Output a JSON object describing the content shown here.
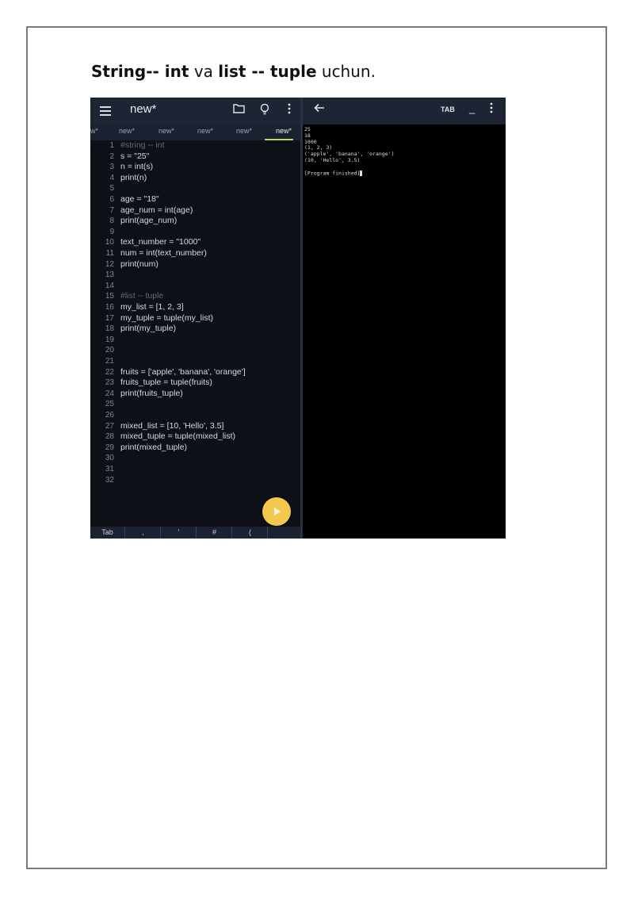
{
  "document": {
    "heading": {
      "part1": "String-- int",
      "part2": " va ",
      "part3": "list -- tuple",
      "part4": " uchun."
    }
  },
  "screenshot": {
    "editor": {
      "title": "new*",
      "icons": [
        "menu-icon",
        "folder-icon",
        "lightbulb-icon",
        "more-vert-icon"
      ],
      "tabs": [
        "w*",
        "new*",
        "new*",
        "new*",
        "new*",
        "new*"
      ],
      "code_lines": [
        "#string -- int",
        "s = \"25\"",
        "n = int(s)",
        "print(n)",
        "",
        "age = \"18\"",
        "age_num = int(age)",
        "print(age_num)",
        "",
        "text_number = \"1000\"",
        "num = int(text_number)",
        "print(num)",
        "",
        "",
        "#list -- tuple",
        "my_list = [1, 2, 3]",
        "my_tuple = tuple(my_list)",
        "print(my_tuple)",
        "",
        "",
        "",
        "fruits = ['apple', 'banana', 'orange']",
        "fruits_tuple = tuple(fruits)",
        "print(fruits_tuple)",
        "",
        "",
        "mixed_list = [10, 'Hello', 3.5]",
        "mixed_tuple = tuple(mixed_list)",
        "print(mixed_tuple)",
        "",
        "",
        ""
      ],
      "keys": [
        "Tab",
        ",",
        "'",
        "#",
        "("
      ]
    },
    "terminal": {
      "tab_label": "TAB",
      "minimize_label": "_",
      "output": [
        "25",
        "18",
        "1000",
        "(1, 2, 3)",
        "('apple', 'banana', 'orange')",
        "(10, 'Hello', 3.5)",
        "",
        "[Program finished]"
      ]
    }
  }
}
